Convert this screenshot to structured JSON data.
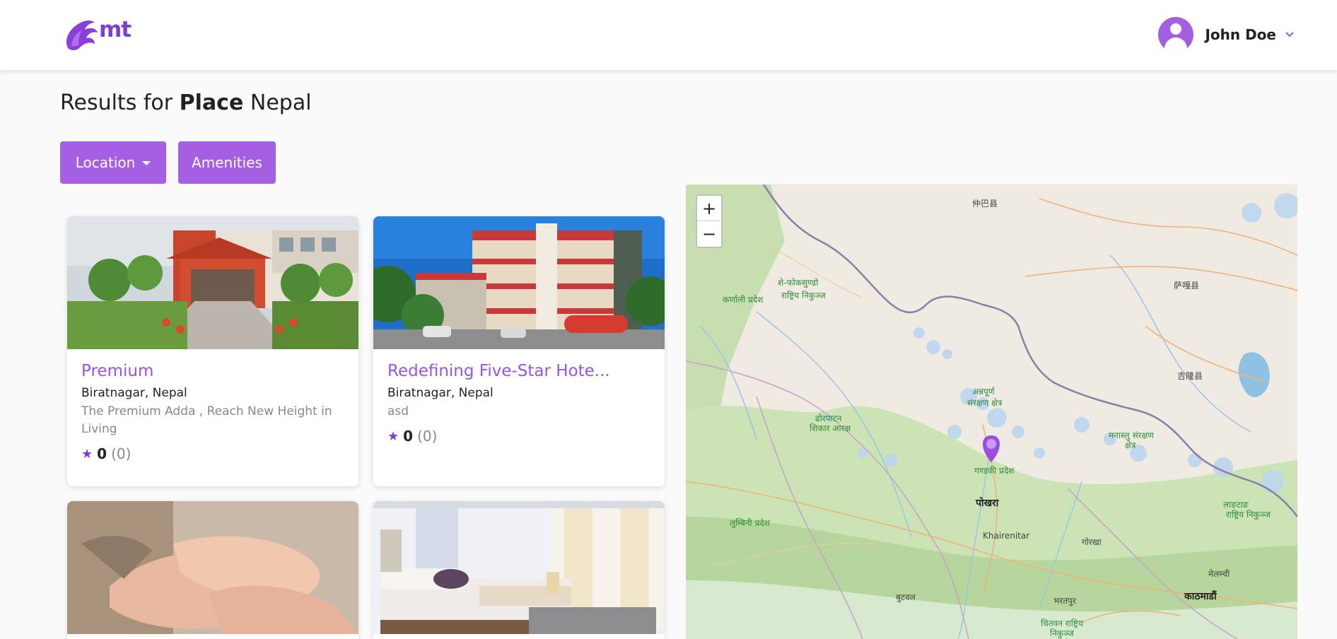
{
  "header": {
    "logo_text": "mt",
    "user_name": "John Doe"
  },
  "results": {
    "prefix": "Results for",
    "filter_type": "Place",
    "query": "Nepal"
  },
  "filters": {
    "location_label": "Location",
    "amenities_label": "Amenities"
  },
  "listings": [
    {
      "title": "Premium",
      "location": "Biratnagar, Nepal",
      "description": "The Premium Adda , Reach New Height in Living",
      "rating": "0",
      "reviews": "(0)"
    },
    {
      "title": "Redefining Five-Star Hote...",
      "location": "Biratnagar, Nepal",
      "description": "asd",
      "rating": "0",
      "reviews": "(0)"
    }
  ],
  "map": {
    "zoom_in": "+",
    "zoom_out": "−",
    "labels": {
      "karnali": "कर्णाली प्रदेश",
      "shey": "शे-फोकसुण्डो",
      "shey2": "राष्ट्रिय निकुञ्ज",
      "annapurna": "अन्नपूर्ण",
      "annapurna2": "संरक्षण क्षेत्र",
      "dhorpatan": "ढोरपाटन",
      "dhorpatan2": "शिकार आरक्ष",
      "manaslu": "मनास्लु संरक्षण",
      "manaslu2": "क्षेत्र",
      "gandaki": "गण्डकी प्रदेश",
      "pokhara": "पोखरा",
      "khairenitar": "Khairenitar",
      "gorkha": "गोरखा",
      "lumbini": "लुम्बिनी प्रदेश",
      "butwal": "बुटवल",
      "bharatpur": "भरतपुर",
      "kathmandu": "काठमाडौं",
      "chitwan": "चितवन राष्ट्रिय",
      "chitwan2": "निकुञ्ज",
      "langtang": "लाङटाङ",
      "langtang2": "राष्ट्रिय निकुञ्ज",
      "melamchi": "मेलम्ची",
      "tibet1": "仲巴县",
      "tibet2": "萨嘎县",
      "tibet3": "吉隆县"
    }
  },
  "colors": {
    "brand": "#a45fe3",
    "title_purple": "#9a55df",
    "star": "#7d3fd3"
  }
}
